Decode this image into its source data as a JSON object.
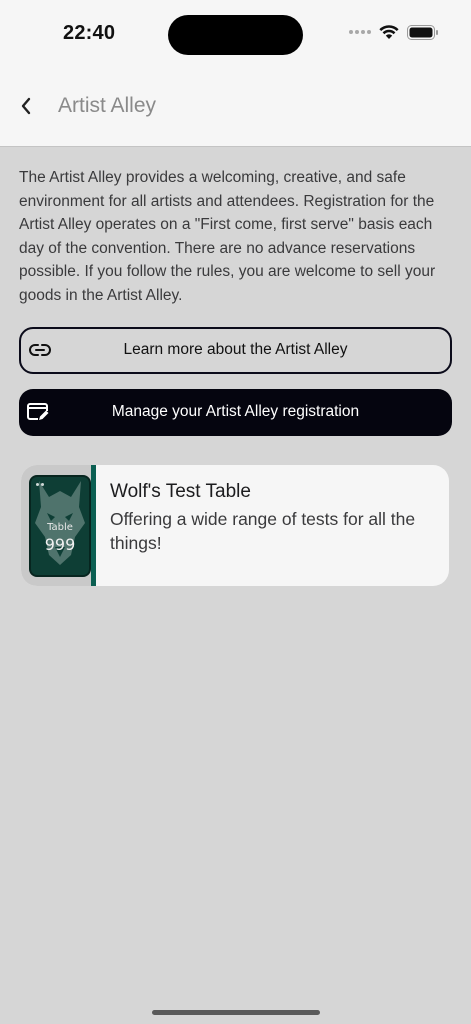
{
  "status_bar": {
    "time": "22:40"
  },
  "nav": {
    "title": "Artist Alley",
    "back_icon": "chevron-left-icon"
  },
  "intro_text": "The Artist Alley provides a welcoming, creative, and safe environment for all artists and attendees. Registration for the Artist Alley operates on a \"First come, first serve\" basis each day of the convention. There are no advance reservations possible. If you follow the rules, you are welcome to sell your goods in the Artist Alley.",
  "buttons": {
    "learn_more": {
      "label": "Learn more about the Artist Alley",
      "icon": "link-icon"
    },
    "manage": {
      "label": "Manage your Artist Alley registration",
      "icon": "edit-window-icon"
    }
  },
  "tables": [
    {
      "name": "Wolf's Test Table",
      "description": "Offering a wide range of tests for all the things!",
      "thumbnail": {
        "label": "Table",
        "number": "999",
        "icon": "wolf-icon"
      },
      "accent_color": "#0b5f52"
    }
  ],
  "colors": {
    "primary_button": "#05050f",
    "accent": "#0b5f52",
    "header_bg": "#f6f6f6",
    "page_bg": "#d6d6d6"
  }
}
